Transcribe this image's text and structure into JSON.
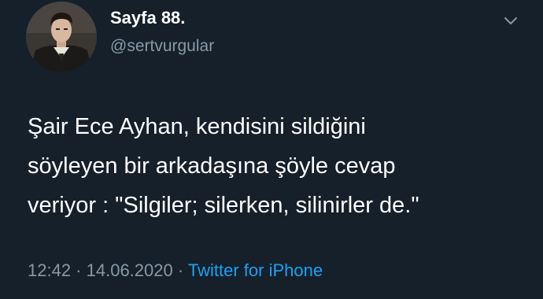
{
  "user": {
    "display_name": "Sayfa 88.",
    "handle": "@sertvurgular"
  },
  "tweet": {
    "lines": [
      "Şair Ece Ayhan, kendisini sildiğini",
      "söyleyen bir arkadaşına şöyle cevap",
      "veriyor : \"Silgiler; silerken, silinirler de.\""
    ],
    "time": "12:42",
    "separator1": " · ",
    "date": "14.06.2020",
    "separator2": " · ",
    "source": "Twitter for iPhone"
  },
  "icons": {
    "menu": "chevron-down-icon",
    "avatar": "avatar"
  },
  "colors": {
    "background": "#15202b",
    "primary_text": "#ffffff",
    "secondary_text": "#8899a6",
    "link": "#1da1f2"
  }
}
